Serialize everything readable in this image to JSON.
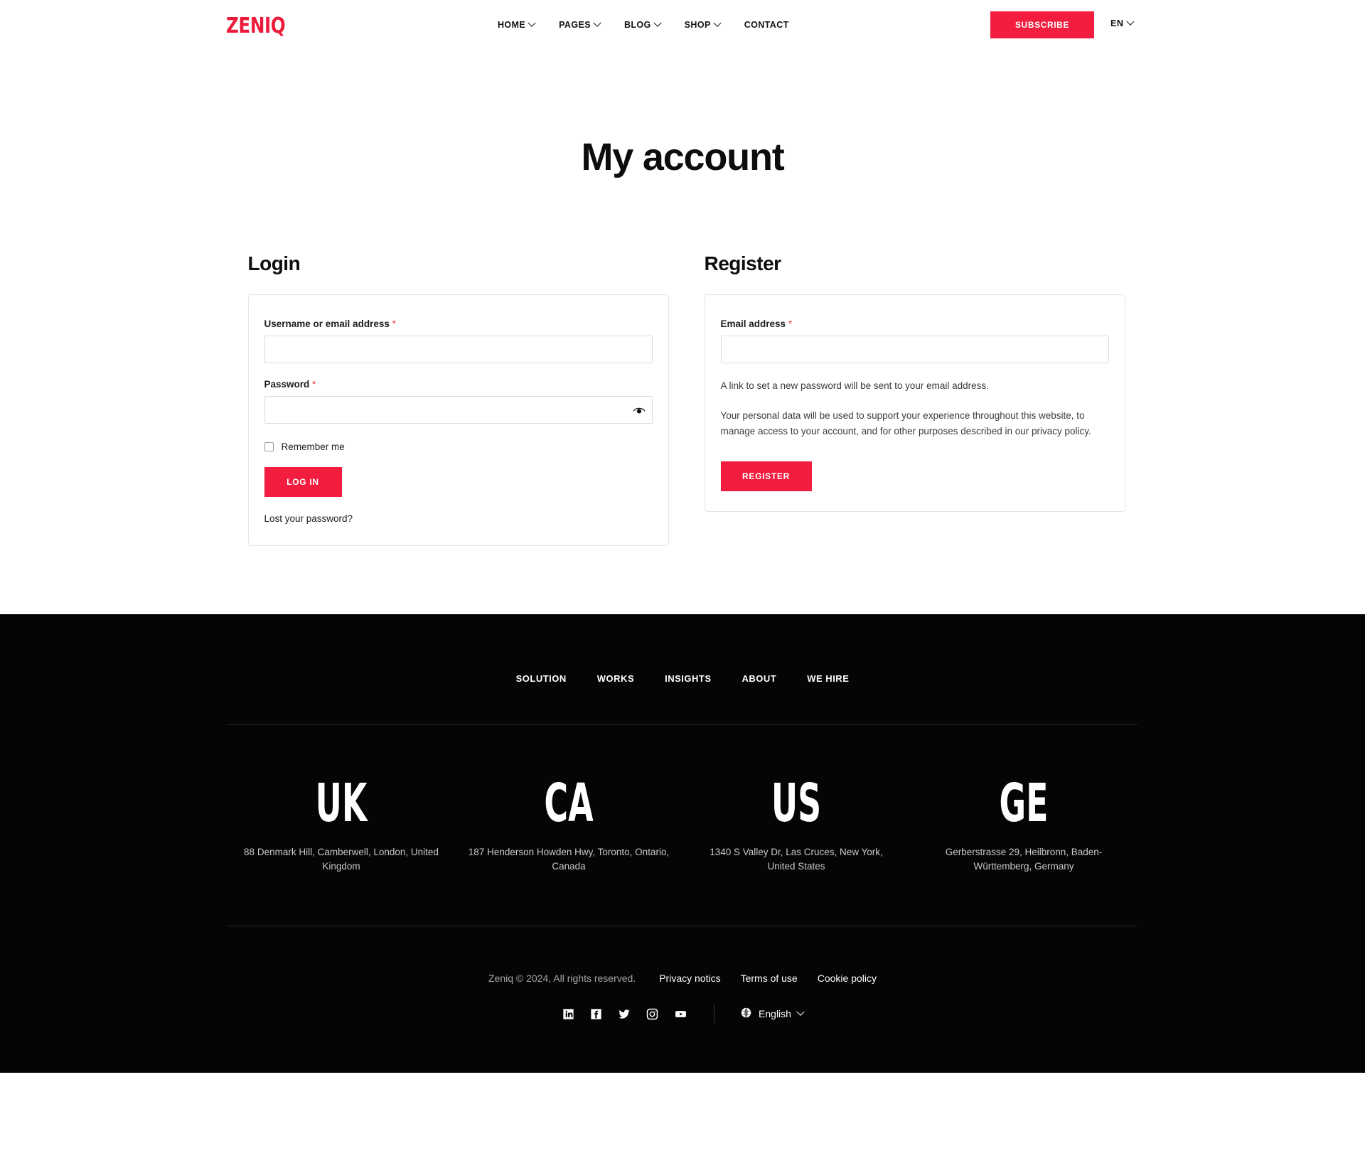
{
  "header": {
    "logo": "ZENIQ",
    "nav": [
      {
        "label": "HOME",
        "has_caret": true
      },
      {
        "label": "PAGES",
        "has_caret": true
      },
      {
        "label": "BLOG",
        "has_caret": true
      },
      {
        "label": "SHOP",
        "has_caret": true
      },
      {
        "label": "CONTACT",
        "has_caret": false
      }
    ],
    "subscribe_label": "SUBSCRIBE",
    "language": "EN"
  },
  "page": {
    "title": "My account"
  },
  "login": {
    "heading": "Login",
    "username_label": "Username or email address",
    "username_value": "",
    "password_label": "Password",
    "password_value": "",
    "required_mark": "*",
    "remember_label": "Remember me",
    "submit_label": "LOG IN",
    "lost_password_label": "Lost your password?"
  },
  "register": {
    "heading": "Register",
    "email_label": "Email address",
    "email_value": "",
    "required_mark": "*",
    "note": "A link to set a new password will be sent to your email address.",
    "privacy": "Your personal data will be used to support your experience throughout this website, to manage access to your account, and for other purposes described in our privacy policy.",
    "submit_label": "REGISTER"
  },
  "footer": {
    "nav": [
      {
        "label": "SOLUTION"
      },
      {
        "label": "WORKS"
      },
      {
        "label": "INSIGHTS"
      },
      {
        "label": "ABOUT"
      },
      {
        "label": "WE HIRE"
      }
    ],
    "offices": [
      {
        "code": "UK",
        "address": "88 Denmark Hill, Camberwell, London, United Kingdom"
      },
      {
        "code": "CA",
        "address": "187 Henderson Howden Hwy, Toronto, Ontario, Canada"
      },
      {
        "code": "US",
        "address": "1340 S Valley Dr, Las Cruces, New York, United States"
      },
      {
        "code": "GE",
        "address": "Gerberstrasse 29, Heilbronn, Baden-Württemberg, Germany"
      }
    ],
    "copyright": "Zeniq © 2024, All rights reserved.",
    "legal_links": [
      {
        "label": "Privacy notics"
      },
      {
        "label": "Terms of use"
      },
      {
        "label": "Cookie policy"
      }
    ],
    "socials": [
      {
        "name": "linkedin"
      },
      {
        "name": "facebook"
      },
      {
        "name": "twitter"
      },
      {
        "name": "instagram"
      },
      {
        "name": "youtube"
      }
    ],
    "language": "English"
  },
  "colors": {
    "accent": "#F21D3F",
    "logo": "#ED1B3B",
    "footer_bg": "#050505",
    "required": "#e8374a"
  }
}
